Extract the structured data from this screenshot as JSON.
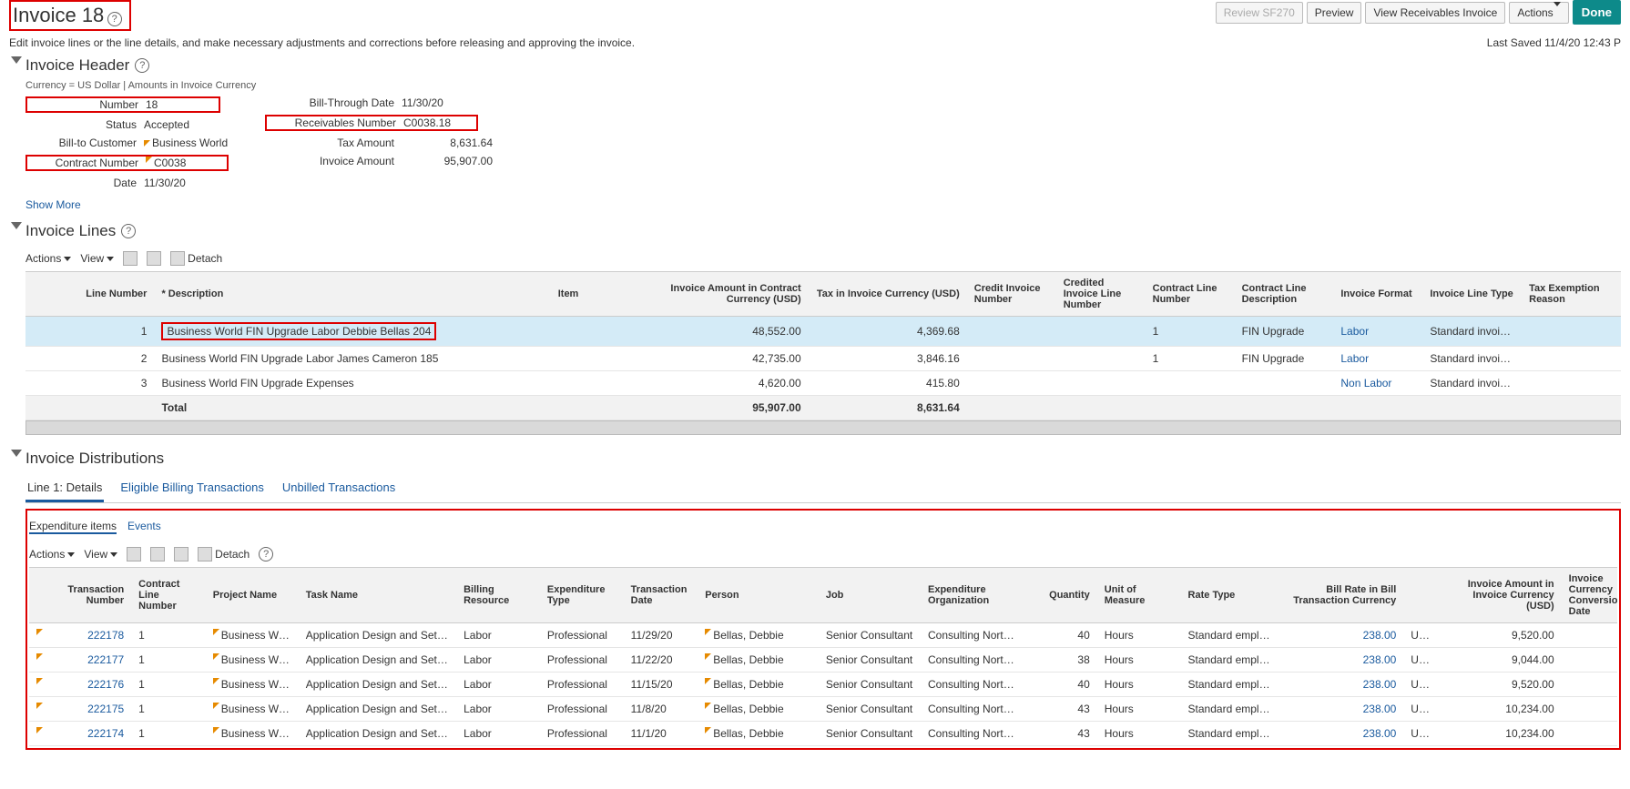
{
  "header": {
    "title": "Invoice 18",
    "subtitle": "Edit invoice lines or the line details, and make necessary adjustments and corrections before releasing and approving the invoice.",
    "last_saved": "Last Saved 11/4/20 12:43 P",
    "done_label": "Done",
    "review_label": "Review SF270",
    "preview_label": "Preview",
    "view_recv_label": "View Receivables Invoice",
    "actions_label": "Actions"
  },
  "invoice_header": {
    "title": "Invoice Header",
    "currency_note": "Currency = US Dollar | Amounts in Invoice Currency",
    "number_label": "Number",
    "number": "18",
    "status_label": "Status",
    "status": "Accepted",
    "bill_to_label": "Bill-to Customer",
    "bill_to": "Business World",
    "contract_label": "Contract Number",
    "contract": "C0038",
    "date_label": "Date",
    "date": "11/30/20",
    "bill_through_label": "Bill-Through Date",
    "bill_through": "11/30/20",
    "recv_num_label": "Receivables Number",
    "recv_num": "C0038.18",
    "tax_amt_label": "Tax Amount",
    "tax_amt": "8,631.64",
    "inv_amt_label": "Invoice Amount",
    "inv_amt": "95,907.00",
    "show_more": "Show More"
  },
  "invoice_lines": {
    "title": "Invoice Lines",
    "actions": "Actions",
    "view": "View",
    "detach": "Detach",
    "cols": {
      "line_num": "Line Number",
      "desc": "* Description",
      "item": "Item",
      "inv_amt": "Invoice Amount in Contract Currency (USD)",
      "tax": "Tax in Invoice Currency (USD)",
      "credit_inv": "Credit Invoice Number",
      "credited_line": "Credited Invoice Line Number",
      "contract_line": "Contract Line Number",
      "contract_desc": "Contract Line Description",
      "inv_format": "Invoice Format",
      "inv_line_type": "Invoice Line Type",
      "tax_exempt": "Tax Exemption Reason"
    },
    "rows": [
      {
        "n": "1",
        "desc": "Business World FIN Upgrade Labor Debbie Bellas 204",
        "item": "",
        "amt": "48,552.00",
        "tax": "4,369.68",
        "ci": "",
        "cil": "",
        "cln": "1",
        "cld": "FIN Upgrade",
        "fmt": "Labor",
        "type": "Standard invoic…",
        "exe": ""
      },
      {
        "n": "2",
        "desc": "Business World FIN Upgrade Labor James Cameron 185",
        "item": "",
        "amt": "42,735.00",
        "tax": "3,846.16",
        "ci": "",
        "cil": "",
        "cln": "1",
        "cld": "FIN Upgrade",
        "fmt": "Labor",
        "type": "Standard invoic…",
        "exe": ""
      },
      {
        "n": "3",
        "desc": "Business World FIN Upgrade Expenses",
        "item": "",
        "amt": "4,620.00",
        "tax": "415.80",
        "ci": "",
        "cil": "",
        "cln": "",
        "cld": "",
        "fmt": "Non Labor",
        "type": "Standard invoic…",
        "exe": ""
      }
    ],
    "total_label": "Total",
    "total_amt": "95,907.00",
    "total_tax": "8,631.64"
  },
  "distributions": {
    "title": "Invoice Distributions",
    "tabs": [
      "Line 1: Details",
      "Eligible Billing Transactions",
      "Unbilled Transactions"
    ],
    "subtabs": [
      "Expenditure items",
      "Events"
    ],
    "actions": "Actions",
    "view": "View",
    "detach": "Detach",
    "cols": {
      "txn": "Transaction Number",
      "cln": "Contract Line Number",
      "proj": "Project Name",
      "task": "Task Name",
      "bill_res": "Billing Resource",
      "exp_type": "Expenditure Type",
      "txn_date": "Transaction Date",
      "person": "Person",
      "job": "Job",
      "exp_org": "Expenditure Organization",
      "qty": "Quantity",
      "uom": "Unit of Measure",
      "rate_type": "Rate Type",
      "bill_rate": "Bill Rate in Bill Transaction Currency",
      "inv_amt": "Invoice Amount in Invoice Currency (USD)",
      "conv_date": "Invoice Currency Conversion Date"
    },
    "rows": [
      {
        "txn": "222178",
        "cln": "1",
        "proj": "Business World…",
        "task": "Application Design and Setup",
        "br": "Labor",
        "et": "Professional",
        "td": "11/29/20",
        "p": "Bellas, Debbie",
        "job": "Senior Consultant",
        "org": "Consulting Nort…",
        "qty": "40",
        "uom": "Hours",
        "rt": "Standard emplo…",
        "rate": "238.00",
        "cur": "USD",
        "amt": "9,520.00"
      },
      {
        "txn": "222177",
        "cln": "1",
        "proj": "Business World…",
        "task": "Application Design and Setup",
        "br": "Labor",
        "et": "Professional",
        "td": "11/22/20",
        "p": "Bellas, Debbie",
        "job": "Senior Consultant",
        "org": "Consulting Nort…",
        "qty": "38",
        "uom": "Hours",
        "rt": "Standard emplo…",
        "rate": "238.00",
        "cur": "USD",
        "amt": "9,044.00"
      },
      {
        "txn": "222176",
        "cln": "1",
        "proj": "Business World…",
        "task": "Application Design and Setup",
        "br": "Labor",
        "et": "Professional",
        "td": "11/15/20",
        "p": "Bellas, Debbie",
        "job": "Senior Consultant",
        "org": "Consulting Nort…",
        "qty": "40",
        "uom": "Hours",
        "rt": "Standard emplo…",
        "rate": "238.00",
        "cur": "USD",
        "amt": "9,520.00"
      },
      {
        "txn": "222175",
        "cln": "1",
        "proj": "Business World…",
        "task": "Application Design and Setup",
        "br": "Labor",
        "et": "Professional",
        "td": "11/8/20",
        "p": "Bellas, Debbie",
        "job": "Senior Consultant",
        "org": "Consulting Nort…",
        "qty": "43",
        "uom": "Hours",
        "rt": "Standard emplo…",
        "rate": "238.00",
        "cur": "USD",
        "amt": "10,234.00"
      },
      {
        "txn": "222174",
        "cln": "1",
        "proj": "Business World…",
        "task": "Application Design and Setup",
        "br": "Labor",
        "et": "Professional",
        "td": "11/1/20",
        "p": "Bellas, Debbie",
        "job": "Senior Consultant",
        "org": "Consulting Nort…",
        "qty": "43",
        "uom": "Hours",
        "rt": "Standard emplo…",
        "rate": "238.00",
        "cur": "USD",
        "amt": "10,234.00"
      }
    ]
  }
}
